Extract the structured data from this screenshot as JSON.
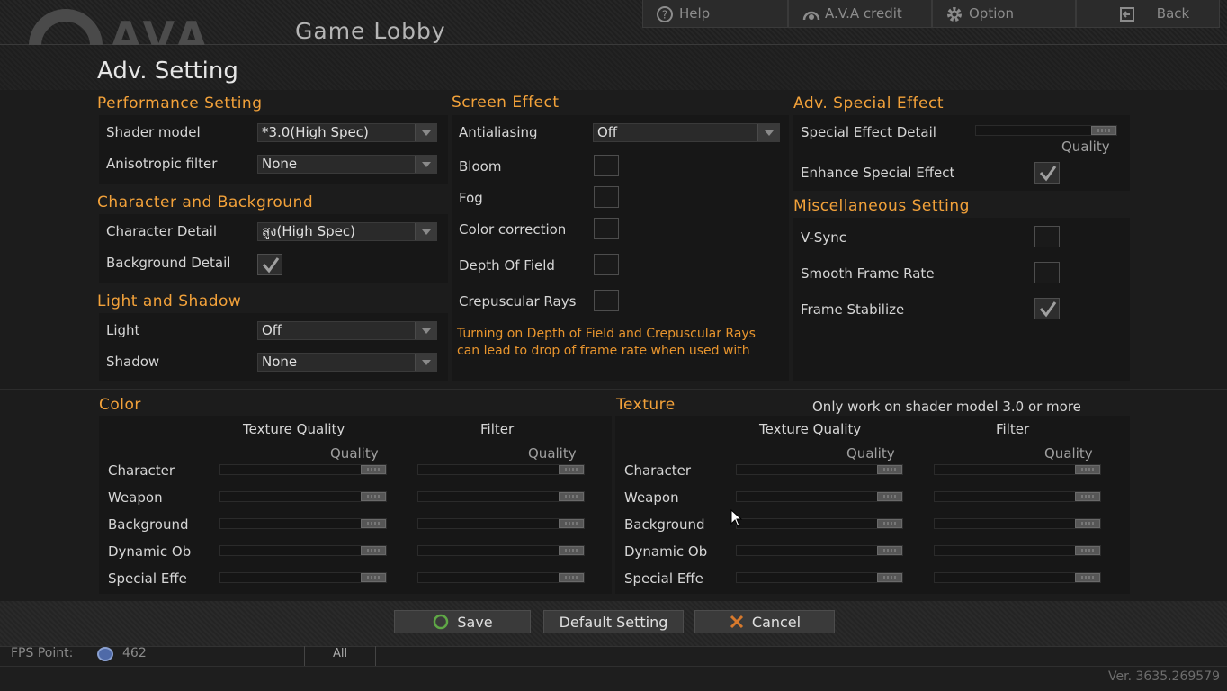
{
  "header": {
    "logo_text": "AVA",
    "title": "Game Lobby",
    "buttons": [
      {
        "label": "Help",
        "icon": "help-icon"
      },
      {
        "label": "A.V.A credit",
        "icon": "credit-icon"
      },
      {
        "label": "Option",
        "icon": "gear-icon"
      },
      {
        "label": "Back",
        "icon": "back-icon"
      }
    ]
  },
  "page_title": "Adv. Setting",
  "performance": {
    "heading": "Performance Setting",
    "shader_model_label": "Shader model",
    "shader_model_value": "*3.0(High Spec)",
    "aniso_label": "Anisotropic filter",
    "aniso_value": "None"
  },
  "character_bg": {
    "heading": "Character and Background",
    "char_detail_label": "Character Detail",
    "char_detail_value": "สูง(High Spec)",
    "bg_detail_label": "Background Detail",
    "bg_detail_checked": true
  },
  "light_shadow": {
    "heading": "Light and Shadow",
    "light_label": "Light",
    "light_value": "Off",
    "shadow_label": "Shadow",
    "shadow_value": "None"
  },
  "screen_effect": {
    "heading": "Screen Effect",
    "aa_label": "Antialiasing",
    "aa_value": "Off",
    "bloom_label": "Bloom",
    "fog_label": "Fog",
    "color_label": "Color correction",
    "dof_label": "Depth Of Field",
    "crep_label": "Crepuscular Rays",
    "warning_line1": "Turning on Depth of Field and Crepuscular Rays",
    "warning_line2": "can lead to drop of frame rate when used with"
  },
  "adv_special": {
    "heading": "Adv. Special Effect",
    "detail_label": "Special Effect Detail",
    "quality_label": "Quality",
    "enhance_label": "Enhance Special Effect",
    "enhance_checked": true
  },
  "misc": {
    "heading": "Miscellaneous Setting",
    "vsync_label": "V-Sync",
    "smooth_label": "Smooth Frame Rate",
    "stabilize_label": "Frame Stabilize",
    "stabilize_checked": true
  },
  "color": {
    "heading": "Color",
    "col1": "Texture Quality",
    "col2": "Filter",
    "quality": "Quality",
    "rows": [
      "Character",
      "Weapon",
      "Background",
      "Dynamic Ob",
      "Special Effe"
    ]
  },
  "texture": {
    "heading": "Texture",
    "note": "Only work on shader model 3.0 or more",
    "col1": "Texture Quality",
    "col2": "Filter",
    "quality": "Quality",
    "rows": [
      "Character",
      "Weapon",
      "Background",
      "Dynamic Ob",
      "Special Effe"
    ]
  },
  "actions": {
    "save": "Save",
    "default": "Default Setting",
    "cancel": "Cancel"
  },
  "status": {
    "fps_label": "FPS Point:",
    "fps_value": "462",
    "tab_all": "All",
    "version": "Ver. 3635.269579"
  },
  "colors": {
    "accent": "#f3a23a",
    "warning": "#e8952e",
    "save_icon": "#5fa846",
    "cancel_icon": "#d7792c"
  }
}
